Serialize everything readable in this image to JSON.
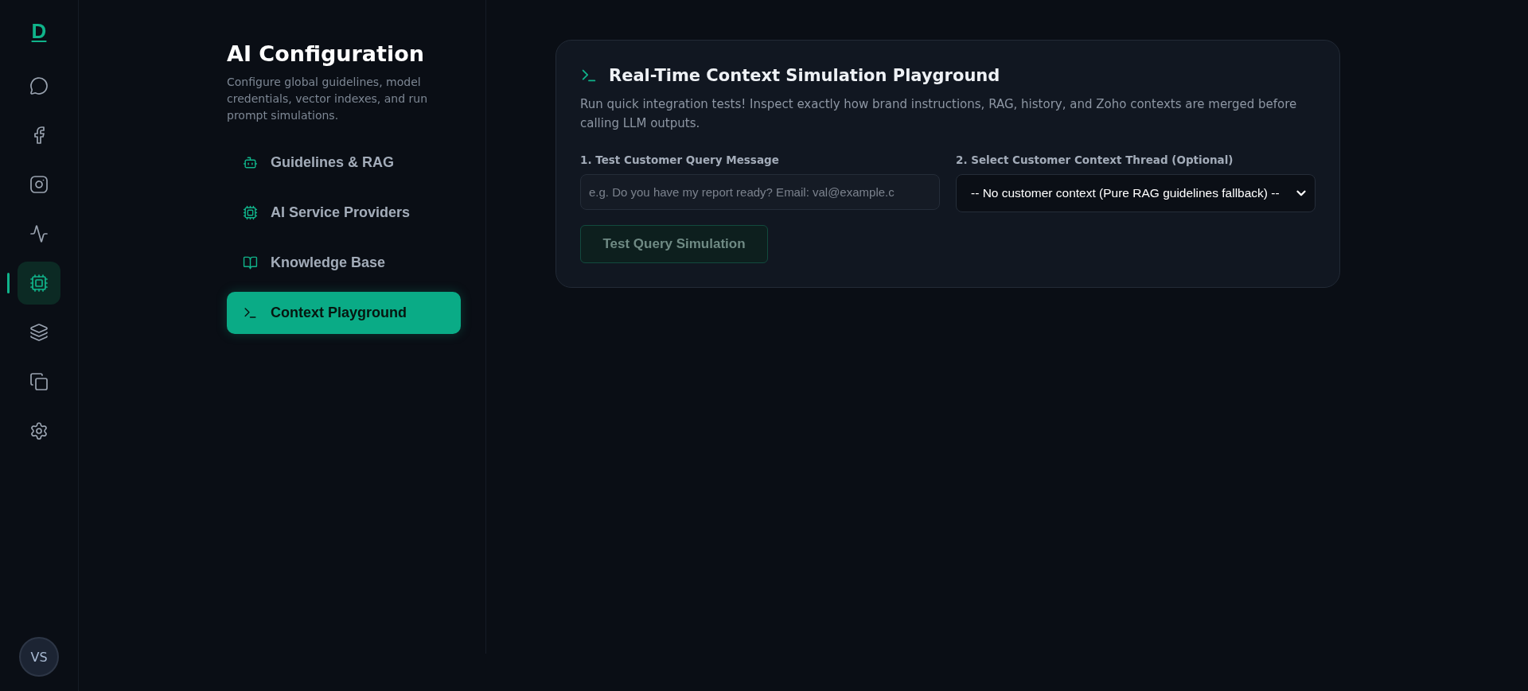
{
  "rail": {
    "logo": "D",
    "items": [
      {
        "kind": "chat",
        "selected": false
      },
      {
        "kind": "facebook",
        "selected": false
      },
      {
        "kind": "instagram",
        "selected": false
      },
      {
        "kind": "activity",
        "selected": false
      },
      {
        "kind": "chip",
        "selected": true
      },
      {
        "kind": "layers",
        "selected": false
      },
      {
        "kind": "copy",
        "selected": false
      },
      {
        "kind": "settings",
        "selected": false
      }
    ],
    "avatar": "VS"
  },
  "panel": {
    "title": "AI Configuration",
    "description": "Configure global guidelines, model credentials, vector indexes, and run prompt simulations.",
    "items": [
      {
        "kind": "bot",
        "label": "Guidelines & RAG",
        "selected": false
      },
      {
        "kind": "chip",
        "label": "AI Service Providers",
        "selected": false
      },
      {
        "kind": "book",
        "label": "Knowledge Base",
        "selected": false
      },
      {
        "kind": "terminal",
        "label": "Context Playground",
        "selected": true
      }
    ]
  },
  "card": {
    "title": "Real-Time Context Simulation Playground",
    "description": "Run quick integration tests! Inspect exactly how brand instructions, RAG, history, and Zoho contexts are merged before calling LLM outputs.",
    "query_label": "1. Test Customer Query Message",
    "query_placeholder": "e.g. Do you have my report ready? Email: val@example.c",
    "thread_label": "2. Select Customer Context Thread (Optional)",
    "thread_value": "-- No customer context (Pure RAG guidelines fallback) --",
    "button": "Test Query Simulation"
  }
}
